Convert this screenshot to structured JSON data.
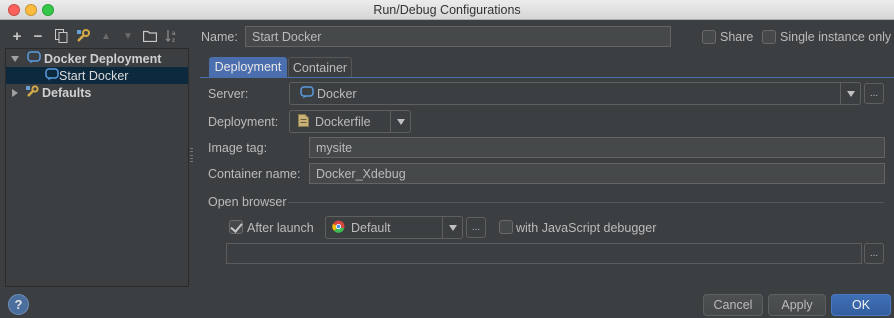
{
  "window": {
    "title": "Run/Debug Configurations"
  },
  "toolbar": {
    "add": "+",
    "remove": "−",
    "copy_icon": "copy-icon",
    "edit_defaults_icon": "wrench-icon",
    "move_up": "▲",
    "move_down": "▼",
    "folder_icon": "folder-icon",
    "sort_icon": "sort-icon"
  },
  "tree": {
    "group": "Docker Deployment",
    "item": "Start Docker",
    "defaults": "Defaults"
  },
  "header": {
    "name_label": "Name:",
    "name_value": "Start Docker",
    "share_label": "Share",
    "single_instance_label": "Single instance only"
  },
  "tabs": [
    "Deployment",
    "Container"
  ],
  "form": {
    "server_label": "Server:",
    "server_value": "Docker",
    "deployment_label": "Deployment:",
    "deployment_value": "Dockerfile",
    "image_tag_label": "Image tag:",
    "image_tag_value": "mysite",
    "container_name_label": "Container name:",
    "container_name_value": "Docker_Xdebug",
    "open_browser_label": "Open browser",
    "after_launch_label": "After launch",
    "after_launch_checked": true,
    "browser_value": "Default",
    "js_debugger_label": "with JavaScript debugger",
    "ellipsis": "..."
  },
  "buttons": {
    "help": "?",
    "cancel": "Cancel",
    "apply": "Apply",
    "ok": "OK"
  },
  "colors": {
    "background": "#3c3f41",
    "accent": "#4b6eaf",
    "selection": "#0d293e"
  }
}
